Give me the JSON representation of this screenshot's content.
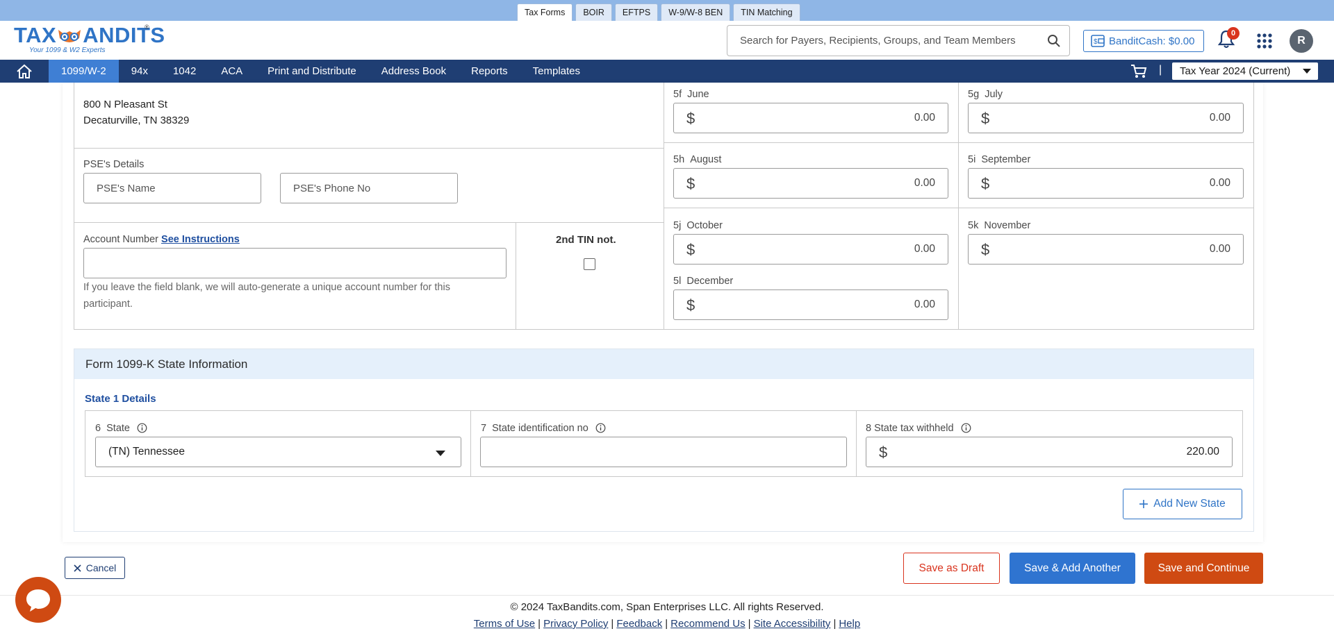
{
  "product_tabs": [
    "Tax Forms",
    "BOIR",
    "EFTPS",
    "W-9/W-8 BEN",
    "TIN Matching"
  ],
  "header": {
    "logo_text_left": "TAX",
    "logo_text_right": "ANDITS",
    "logo_tagline": "Your 1099 & W2 Experts",
    "logo_reg": "®",
    "search_placeholder": "Search for Payers, Recipients, Groups, and Team Members",
    "bandit_cash": "BanditCash: $0.00",
    "notification_count": "0",
    "avatar_initial": "R"
  },
  "nav": {
    "items": [
      "1099/W-2",
      "94x",
      "1042",
      "ACA",
      "Print and Distribute",
      "Address Book",
      "Reports",
      "Templates"
    ],
    "separator": "|",
    "tax_year": "Tax Year 2024 (Current)"
  },
  "payer": {
    "address_line1": "800 N Pleasant St",
    "address_line2": "Decaturville, TN 38329"
  },
  "pse": {
    "section_label": "PSE's Details",
    "name_placeholder": "PSE's Name",
    "phone_placeholder": "PSE's Phone No"
  },
  "account": {
    "label": "Account Number",
    "link": "See Instructions",
    "value": "",
    "helper": "If you leave the field blank, we will auto-generate a unique account number for this participant."
  },
  "tin": {
    "label": "2nd TIN not.",
    "checked": false
  },
  "months": [
    {
      "code": "5f",
      "name": "June",
      "value": "0.00"
    },
    {
      "code": "5g",
      "name": "July",
      "value": "0.00"
    },
    {
      "code": "5h",
      "name": "August",
      "value": "0.00"
    },
    {
      "code": "5i",
      "name": "September",
      "value": "0.00"
    },
    {
      "code": "5j",
      "name": "October",
      "value": "0.00"
    },
    {
      "code": "5k",
      "name": "November",
      "value": "0.00"
    },
    {
      "code": "5l",
      "name": "December",
      "value": "0.00"
    }
  ],
  "currency_symbol": "$",
  "state_section": {
    "title": "Form 1099-K  State Information",
    "state1_title": "State 1 Details",
    "state_label_num": "6",
    "state_label": "State",
    "state_value": "(TN) Tennessee",
    "state_id_num": "7",
    "state_id_label": "State identification no",
    "state_id_value": "",
    "tax_withheld_label": "8 State tax withheld",
    "tax_withheld_value": "220.00",
    "add_state_label": "Add New State"
  },
  "actions": {
    "cancel": "Cancel",
    "save_draft": "Save as Draft",
    "save_add_another": "Save & Add Another",
    "save_continue": "Save and Continue"
  },
  "footer": {
    "copyright": "© 2024 TaxBandits.com, Span Enterprises LLC. All rights Reserved.",
    "links": [
      "Terms of Use",
      "Privacy Policy",
      "Feedback",
      "Recommend Us",
      "Site Accessibility",
      "Help"
    ]
  },
  "colors": {
    "brand_blue": "#2f74c6",
    "nav_navy": "#1f3e73",
    "nav_active": "#3f7fd4",
    "accent_orange": "#cf4a12",
    "alert_red": "#d9341e"
  }
}
